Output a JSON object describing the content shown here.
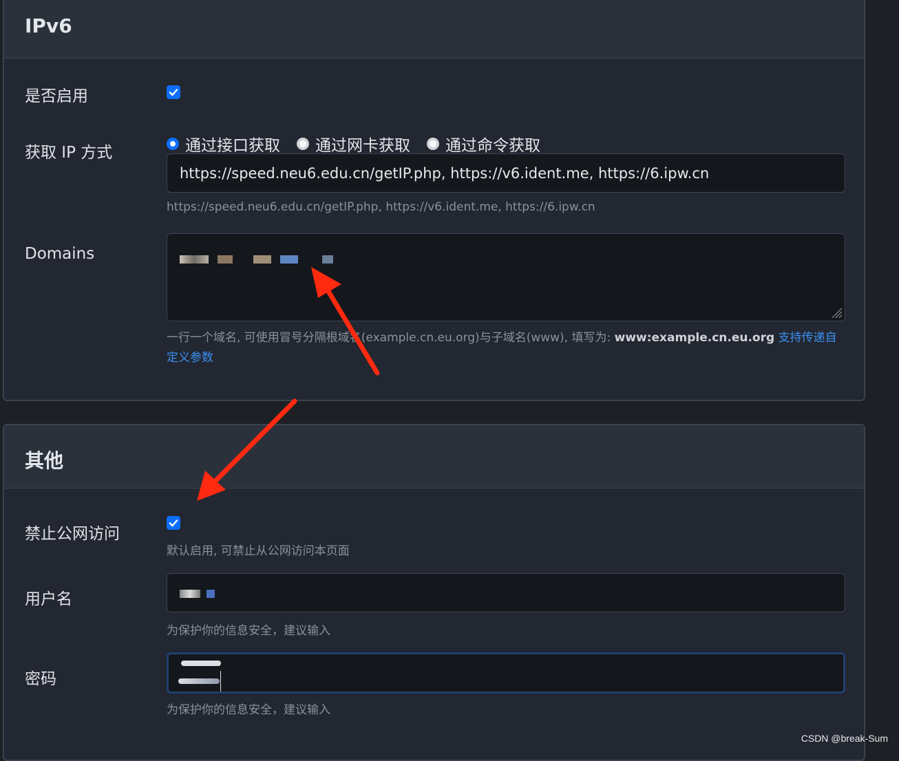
{
  "ipv6": {
    "title": "IPv6",
    "enable_label": "是否启用",
    "enable_checked": true,
    "ip_method_label": "获取 IP 方式",
    "ip_methods": [
      {
        "label": "通过接口获取",
        "checked": true
      },
      {
        "label": "通过网卡获取",
        "checked": false
      },
      {
        "label": "通过命令获取",
        "checked": false
      }
    ],
    "url_value": "https://speed.neu6.edu.cn/getIP.php, https://v6.ident.me, https://6.ipw.cn",
    "url_help": "https://speed.neu6.edu.cn/getIP.php, https://v6.ident.me, https://6.ipw.cn",
    "domains_label": "Domains",
    "domains_help_prefix": "一行一个域名, 可使用冒号分隔根域名(example.cn.eu.org)与子域名(www), 填写为: ",
    "domains_help_example": "www:example.cn.eu.org",
    "domains_help_link": "支持传递自定义参数"
  },
  "other": {
    "title": "其他",
    "block_public_label": "禁止公网访问",
    "block_public_checked": true,
    "block_public_help": "默认启用, 可禁止从公网访问本页面",
    "username_label": "用户名",
    "username_help": "为保护你的信息安全，建议输入",
    "password_label": "密码",
    "password_help": "为保护你的信息安全，建议输入"
  },
  "watermark": "CSDN @break-Sum",
  "colors": {
    "accent": "#0d6efd",
    "link": "#3b8ff3",
    "arrow": "#ff2a10",
    "background": "#1d2025",
    "card": "#222731"
  }
}
